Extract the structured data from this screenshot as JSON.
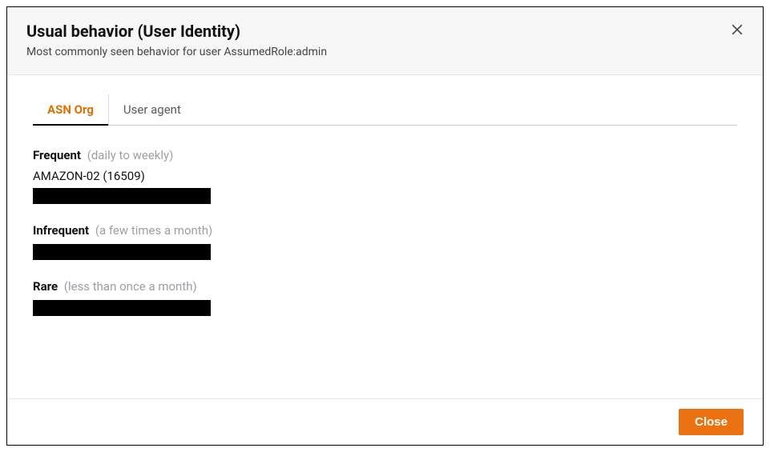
{
  "header": {
    "title": "Usual behavior (User Identity)",
    "subtitle": "Most commonly seen behavior for user AssumedRole:admin"
  },
  "tabs": [
    {
      "label": "ASN Org",
      "active": true
    },
    {
      "label": "User agent",
      "active": false
    }
  ],
  "sections": {
    "frequent": {
      "label": "Frequent",
      "hint": "(daily to weekly)",
      "value": "AMAZON-02 (16509)"
    },
    "infrequent": {
      "label": "Infrequent",
      "hint": "(a few times a month)"
    },
    "rare": {
      "label": "Rare",
      "hint": "(less than once a month)"
    }
  },
  "footer": {
    "close_label": "Close"
  }
}
